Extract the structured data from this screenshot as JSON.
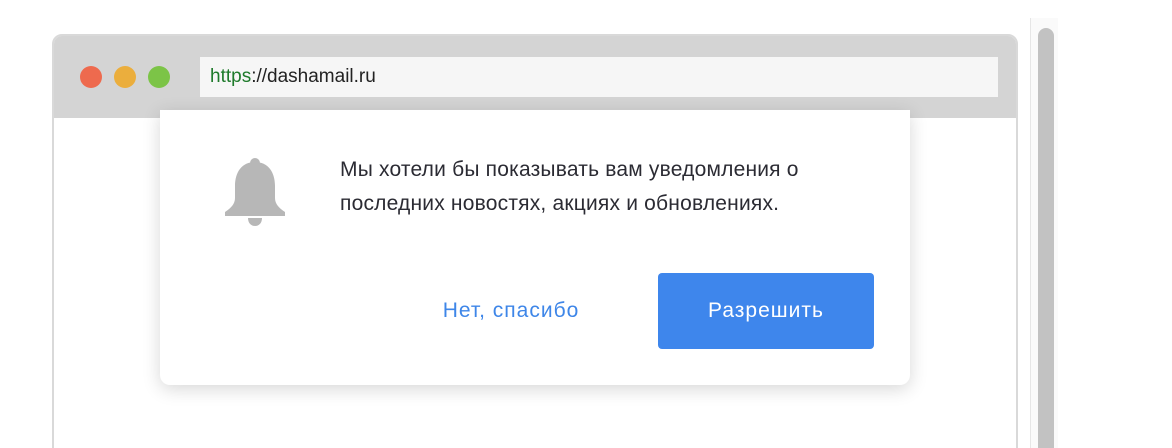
{
  "browser": {
    "url_scheme": "https",
    "url_rest": "://dashamail.ru"
  },
  "prompt": {
    "icon": "bell-icon",
    "message": "Мы хотели бы показывать вам уведомления о последних новостях, акциях и обновлениях.",
    "deny_label": "Нет, спасибо",
    "allow_label": "Разрешить"
  },
  "colors": {
    "accent": "#3e86ec",
    "url_scheme": "#1e7a2b",
    "traffic_close": "#ee6a4e",
    "traffic_minimize": "#ebae3d",
    "traffic_maximize": "#7cc447",
    "icon_gray": "#b7b7b7"
  }
}
